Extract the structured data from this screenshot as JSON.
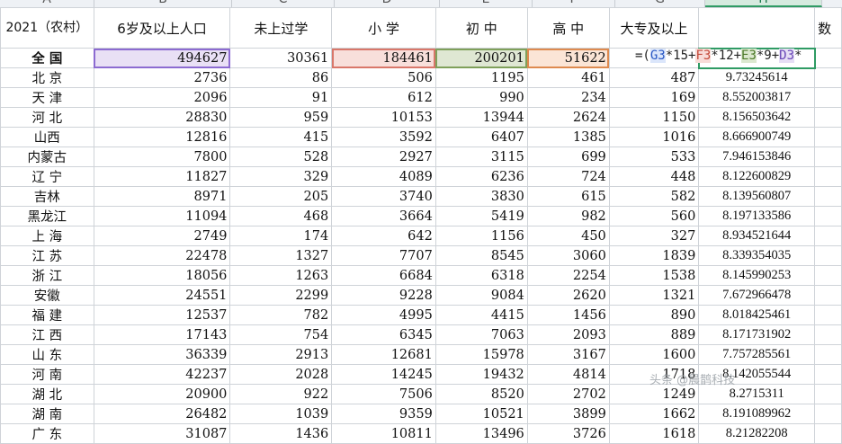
{
  "columns": [
    "A",
    "B",
    "C",
    "D",
    "E",
    "F",
    "G",
    "H"
  ],
  "header": {
    "region": "2021（农村）",
    "pop6": "6岁及以上人口",
    "none": "未上过学",
    "primary": "小 学",
    "junior": "初 中",
    "senior": "高 中",
    "college": "大专及以上",
    "h_partial": "数"
  },
  "formula": {
    "prefix": "=(",
    "ref1": "G3",
    "op1": "*15+",
    "ref2": "F3",
    "op2": "*12+",
    "ref3": "E3",
    "op3": "*9+",
    "ref4": "D3",
    "op4": "*"
  },
  "rows": [
    {
      "region": "全  国",
      "b": "494627",
      "c": "30361",
      "d": "184461",
      "e": "200201",
      "f": "51622",
      "g": "",
      "h": ""
    },
    {
      "region": "北 京",
      "b": "2736",
      "c": "86",
      "d": "506",
      "e": "1195",
      "f": "461",
      "g": "487",
      "h": "9.73245614"
    },
    {
      "region": "天 津",
      "b": "2096",
      "c": "91",
      "d": "612",
      "e": "990",
      "f": "234",
      "g": "169",
      "h": "8.552003817"
    },
    {
      "region": "河 北",
      "b": "28830",
      "c": "959",
      "d": "10153",
      "e": "13944",
      "f": "2624",
      "g": "1150",
      "h": "8.156503642"
    },
    {
      "region": "山西",
      "b": "12816",
      "c": "415",
      "d": "3592",
      "e": "6407",
      "f": "1385",
      "g": "1016",
      "h": "8.666900749"
    },
    {
      "region": "内蒙古",
      "b": "7800",
      "c": "528",
      "d": "2927",
      "e": "3115",
      "f": "699",
      "g": "533",
      "h": "7.946153846"
    },
    {
      "region": "辽 宁",
      "b": "11827",
      "c": "329",
      "d": "4089",
      "e": "6236",
      "f": "724",
      "g": "448",
      "h": "8.122600829"
    },
    {
      "region": "吉林",
      "b": "8971",
      "c": "205",
      "d": "3740",
      "e": "3830",
      "f": "615",
      "g": "582",
      "h": "8.139560807"
    },
    {
      "region": "黑龙江",
      "b": "11094",
      "c": "468",
      "d": "3664",
      "e": "5419",
      "f": "982",
      "g": "560",
      "h": "8.197133586"
    },
    {
      "region": "上 海",
      "b": "2749",
      "c": "174",
      "d": "642",
      "e": "1156",
      "f": "450",
      "g": "327",
      "h": "8.934521644"
    },
    {
      "region": "江 苏",
      "b": "22478",
      "c": "1327",
      "d": "7707",
      "e": "8545",
      "f": "3060",
      "g": "1839",
      "h": "8.339354035"
    },
    {
      "region": "浙 江",
      "b": "18056",
      "c": "1263",
      "d": "6684",
      "e": "6318",
      "f": "2254",
      "g": "1538",
      "h": "8.145990253"
    },
    {
      "region": "安徽",
      "b": "24551",
      "c": "2299",
      "d": "9228",
      "e": "9084",
      "f": "2620",
      "g": "1321",
      "h": "7.672966478"
    },
    {
      "region": "福 建",
      "b": "12537",
      "c": "782",
      "d": "4995",
      "e": "4415",
      "f": "1456",
      "g": "890",
      "h": "8.018425461"
    },
    {
      "region": "江 西",
      "b": "17143",
      "c": "754",
      "d": "6345",
      "e": "7063",
      "f": "2093",
      "g": "889",
      "h": "8.171731902"
    },
    {
      "region": "山 东",
      "b": "36339",
      "c": "2913",
      "d": "12681",
      "e": "15978",
      "f": "3167",
      "g": "1600",
      "h": "7.757285561"
    },
    {
      "region": "河 南",
      "b": "42237",
      "c": "2028",
      "d": "14245",
      "e": "19432",
      "f": "4814",
      "g": "1718",
      "h": "8.142055544"
    },
    {
      "region": "湖 北",
      "b": "20900",
      "c": "922",
      "d": "7506",
      "e": "8520",
      "f": "2702",
      "g": "1249",
      "h": "8.2715311"
    },
    {
      "region": "湖 南",
      "b": "26482",
      "c": "1039",
      "d": "9359",
      "e": "10521",
      "f": "3899",
      "g": "1662",
      "h": "8.191089962"
    },
    {
      "region": "广 东",
      "b": "31087",
      "c": "1436",
      "d": "10811",
      "e": "13496",
      "f": "3726",
      "g": "1618",
      "h": "8.21282208"
    }
  ],
  "watermark": "头条 @晨鹊科技"
}
